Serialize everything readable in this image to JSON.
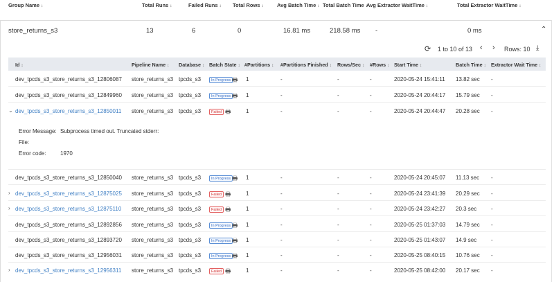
{
  "group_header": {
    "group_name": "Group Name",
    "total_runs": "Total Runs",
    "failed_runs": "Failed Runs",
    "total_rows": "Total Rows",
    "avg_batch_time": "Avg Batch Time",
    "total_batch_time": "Total Batch Time",
    "avg_extractor_wait": "Avg Extractor WaitTime",
    "total_extractor_wait": "Total Extractor WaitTime"
  },
  "group": {
    "name": "store_returns_s3",
    "total_runs": "13",
    "failed_runs": "6",
    "total_rows": "0",
    "avg_batch_time": "16.81 ms",
    "total_batch_time": "218.58 ms",
    "avg_extractor_wait": "-",
    "total_extractor_wait": "0 ms"
  },
  "icons": {
    "sort": "↕",
    "collapse": "⌃",
    "refresh": "⟳",
    "prev": "‹",
    "next": "›",
    "download": "⤓",
    "expanded": "⌄",
    "collapsed": "›",
    "print": "🖶"
  },
  "pager": {
    "range": "1 to 10 of 13",
    "rows_label": "Rows: 10"
  },
  "columns": {
    "id": "Id",
    "pipeline": "Pipeline Name",
    "database": "Database",
    "batch_state": "Batch State",
    "partitions": "#Partitions",
    "partitions_finished": "#Partitions Finished",
    "rows_sec": "Rows/Sec",
    "rows": "#Rows",
    "start_time": "Start Time",
    "batch_time": "Batch Time",
    "extractor_wait": "Extractor Wait Time"
  },
  "rows": [
    {
      "id": "dev_tpcds_s3_store_returns_s3_12806087",
      "pipeline": "store_returns_s3",
      "database": "tpcds_s3",
      "state": "In Progress",
      "partitions": "1",
      "partitions_finished": "-",
      "rows_sec": "-",
      "rows": "-",
      "start": "2020-05-24 15:41:11",
      "batch": "13.82 sec",
      "wait": "-"
    },
    {
      "id": "dev_tpcds_s3_store_returns_s3_12849960",
      "pipeline": "store_returns_s3",
      "database": "tpcds_s3",
      "state": "In Progress",
      "partitions": "1",
      "partitions_finished": "-",
      "rows_sec": "-",
      "rows": "-",
      "start": "2020-05-24 20:44:17",
      "batch": "15.79 sec",
      "wait": "-"
    },
    {
      "id": "dev_tpcds_s3_store_returns_s3_12850011",
      "pipeline": "store_returns_s3",
      "database": "tpcds_s3",
      "state": "Failed",
      "partitions": "1",
      "partitions_finished": "-",
      "rows_sec": "-",
      "rows": "-",
      "start": "2020-05-24 20:44:47",
      "batch": "20.28 sec",
      "wait": "-"
    },
    {
      "id": "dev_tpcds_s3_store_returns_s3_12850040",
      "pipeline": "store_returns_s3",
      "database": "tpcds_s3",
      "state": "In Progress",
      "partitions": "1",
      "partitions_finished": "-",
      "rows_sec": "-",
      "rows": "-",
      "start": "2020-05-24 20:45:07",
      "batch": "11.13 sec",
      "wait": "-"
    },
    {
      "id": "dev_tpcds_s3_store_returns_s3_12875025",
      "pipeline": "store_returns_s3",
      "database": "tpcds_s3",
      "state": "Failed",
      "partitions": "1",
      "partitions_finished": "-",
      "rows_sec": "-",
      "rows": "-",
      "start": "2020-05-24 23:41:39",
      "batch": "20.29 sec",
      "wait": "-"
    },
    {
      "id": "dev_tpcds_s3_store_returns_s3_12875110",
      "pipeline": "store_returns_s3",
      "database": "tpcds_s3",
      "state": "Failed",
      "partitions": "1",
      "partitions_finished": "-",
      "rows_sec": "-",
      "rows": "-",
      "start": "2020-05-24 23:42:27",
      "batch": "20.3 sec",
      "wait": "-"
    },
    {
      "id": "dev_tpcds_s3_store_returns_s3_12892856",
      "pipeline": "store_returns_s3",
      "database": "tpcds_s3",
      "state": "In Progress",
      "partitions": "1",
      "partitions_finished": "-",
      "rows_sec": "-",
      "rows": "-",
      "start": "2020-05-25 01:37:03",
      "batch": "14.79 sec",
      "wait": "-"
    },
    {
      "id": "dev_tpcds_s3_store_returns_s3_12893720",
      "pipeline": "store_returns_s3",
      "database": "tpcds_s3",
      "state": "In Progress",
      "partitions": "1",
      "partitions_finished": "-",
      "rows_sec": "-",
      "rows": "-",
      "start": "2020-05-25 01:43:07",
      "batch": "14.9 sec",
      "wait": "-"
    },
    {
      "id": "dev_tpcds_s3_store_returns_s3_12956031",
      "pipeline": "store_returns_s3",
      "database": "tpcds_s3",
      "state": "In Progress",
      "partitions": "1",
      "partitions_finished": "-",
      "rows_sec": "-",
      "rows": "-",
      "start": "2020-05-25 08:40:15",
      "batch": "10.76 sec",
      "wait": "-"
    },
    {
      "id": "dev_tpcds_s3_store_returns_s3_12956311",
      "pipeline": "store_returns_s3",
      "database": "tpcds_s3",
      "state": "Failed",
      "partitions": "1",
      "partitions_finished": "-",
      "rows_sec": "-",
      "rows": "-",
      "start": "2020-05-25 08:42:00",
      "batch": "20.17 sec",
      "wait": "-"
    }
  ],
  "error_detail": {
    "message_label": "Error Message:",
    "message": "Subprocess timed out. Truncated stderr:",
    "file_label": "File:",
    "code_label": "Error code:",
    "code": "1970"
  }
}
